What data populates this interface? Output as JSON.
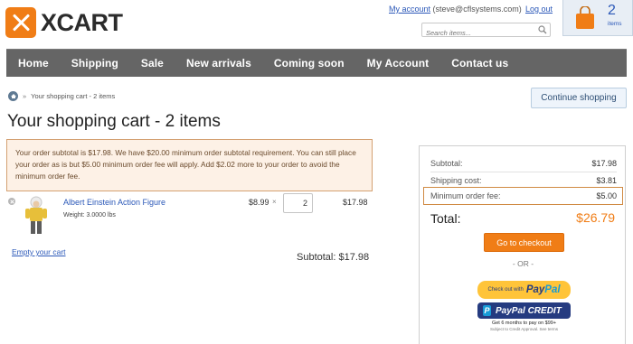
{
  "brand": {
    "name": "XCART"
  },
  "header": {
    "my_account_label": "My account",
    "user_email": "(steve@cflsystems.com)",
    "logout_label": "Log out",
    "search_placeholder": "Search items...",
    "cart_count": "2",
    "cart_items_label": "items"
  },
  "nav": {
    "items": [
      {
        "label": "Home"
      },
      {
        "label": "Shipping"
      },
      {
        "label": "Sale"
      },
      {
        "label": "New arrivals"
      },
      {
        "label": "Coming soon"
      },
      {
        "label": "My Account"
      },
      {
        "label": "Contact us"
      }
    ]
  },
  "breadcrumb": {
    "separator": "»",
    "current": "Your shopping cart - 2 items"
  },
  "continue_shopping_label": "Continue shopping",
  "page_title": "Your shopping cart - 2 items",
  "notice": "Your order subtotal is $17.98. We have $20.00 minimum order subtotal requirement. You can still place your order as is but $5.00 minimum order fee will apply. Add $2.02 more to your order to avoid the minimum order fee.",
  "cart_item": {
    "name": "Albert Einstein Action Figure",
    "weight": "Weight: 3.0000 lbs",
    "price": "$8.99",
    "times": "×",
    "quantity": "2",
    "total": "$17.98"
  },
  "empty_cart_label": "Empty your cart",
  "subtotal_line": "Subtotal: $17.98",
  "summary": {
    "subtotal_label": "Subtotal:",
    "subtotal_value": "$17.98",
    "shipping_label": "Shipping cost:",
    "shipping_value": "$3.81",
    "min_fee_label": "Minimum order fee:",
    "min_fee_value": "$5.00",
    "total_label": "Total:",
    "total_value": "$26.79",
    "checkout_label": "Go to checkout",
    "or_label": "- OR -",
    "paypal_small": "Check out with",
    "paypal_pay": "Pay",
    "paypal_pal": "Pal",
    "paypal_credit_label": "PayPal CREDIT",
    "paypal_credit_note": "Get 6 months to pay on $99+",
    "paypal_credit_subnote": "Subject to Credit Approval. See terms"
  },
  "colors": {
    "accent": "#f07d16",
    "nav_bg": "#656565",
    "link": "#2b58b8",
    "paypal_yellow": "#ffc439",
    "paypal_navy": "#253b80"
  }
}
